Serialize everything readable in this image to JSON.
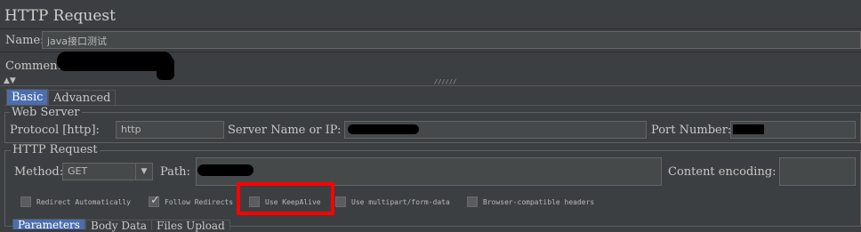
{
  "header": {
    "title": "HTTP Request",
    "name_label": "Name:",
    "name_value": "java接口测试",
    "comments_label": "Comments:"
  },
  "tabs": [
    {
      "label": "Basic",
      "active": true
    },
    {
      "label": "Advanced",
      "active": false
    }
  ],
  "web_server": {
    "group_title": "Web Server",
    "protocol_label": "Protocol [http]:",
    "protocol_value": "http",
    "server_label": "Server Name or IP:",
    "port_label": "Port Number:"
  },
  "http_request": {
    "group_title": "HTTP Request",
    "method_label": "Method:",
    "method_value": "GET",
    "path_label": "Path:",
    "encoding_label": "Content encoding:"
  },
  "options": [
    {
      "label": "Redirect Automatically",
      "checked": false
    },
    {
      "label": "Follow Redirects",
      "checked": true
    },
    {
      "label": "Use KeepAlive",
      "checked": false,
      "highlighted": true
    },
    {
      "label": "Use multipart/form-data",
      "checked": false
    },
    {
      "label": "Browser-compatible headers",
      "checked": false
    }
  ],
  "bottom_tabs": [
    {
      "label": "Parameters"
    },
    {
      "label": "Body Data"
    },
    {
      "label": "Files Upload"
    }
  ],
  "colors": {
    "background": "#3c3f41",
    "active_tab": "#4b6eaf",
    "highlight": "#ff0000"
  }
}
